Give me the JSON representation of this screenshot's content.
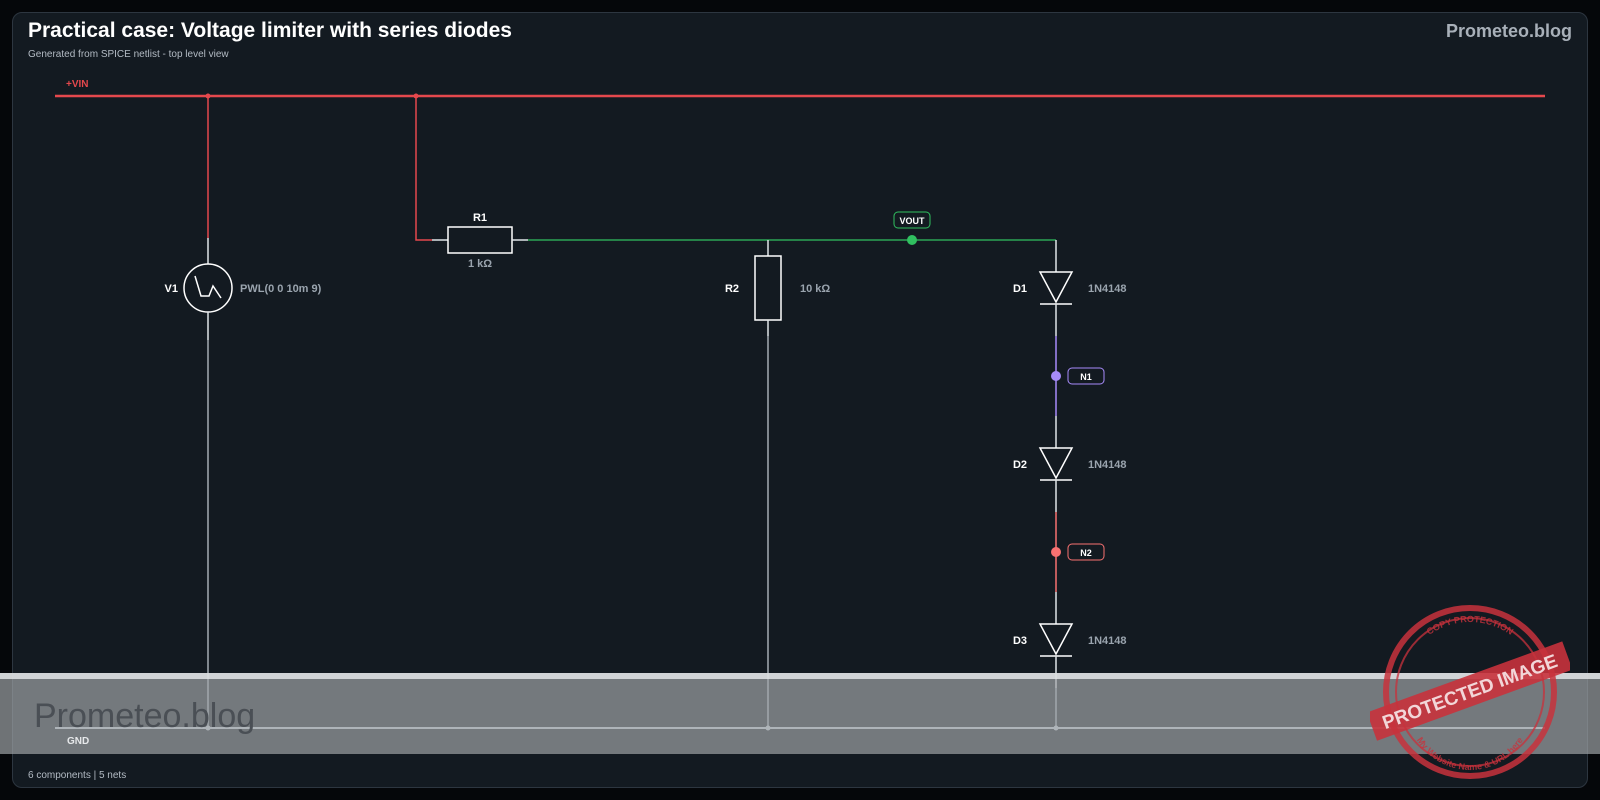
{
  "header": {
    "title": "Practical case: Voltage limiter with series diodes",
    "subtitle": "Generated from SPICE netlist - top level view",
    "brand": "Prometeo.blog"
  },
  "footer": {
    "summary": "6 components | 5 nets"
  },
  "nets": {
    "vin": {
      "label": "+VIN",
      "color": "#e5484d"
    },
    "gnd": {
      "label": "GND",
      "color": "#c8d0d8"
    },
    "vout": {
      "label": "VOUT",
      "color": "#30c060"
    },
    "n1": {
      "label": "N1",
      "color": "#a78bfa"
    },
    "n2": {
      "label": "N2",
      "color": "#f87171"
    }
  },
  "components": {
    "v1": {
      "ref": "V1",
      "value": "PWL(0 0 10m 9)",
      "icon": "pwl-voltage-source-icon"
    },
    "r1": {
      "ref": "R1",
      "value": "1 kΩ",
      "icon": "resistor-icon"
    },
    "r2": {
      "ref": "R2",
      "value": "10 kΩ",
      "icon": "resistor-icon"
    },
    "d1": {
      "ref": "D1",
      "value": "1N4148",
      "icon": "diode-icon"
    },
    "d2": {
      "ref": "D2",
      "value": "1N4148",
      "icon": "diode-icon"
    },
    "d3": {
      "ref": "D3",
      "value": "1N4148",
      "icon": "diode-icon"
    }
  },
  "watermark": {
    "text": "Prometeo.blog",
    "stamp_main": "PROTECTED IMAGE",
    "stamp_top": "COPY PROTECTION",
    "stamp_bottom": "My Website Name & URL here"
  }
}
